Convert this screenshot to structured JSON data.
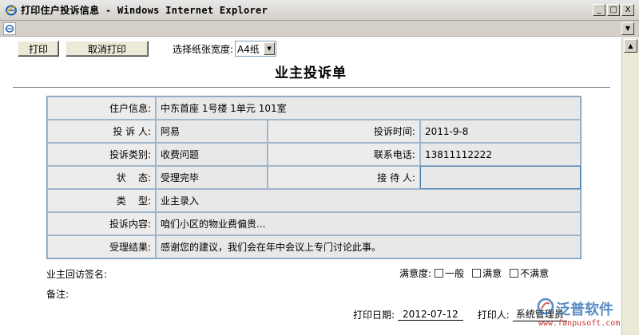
{
  "window": {
    "title": "打印住户投诉信息 - Windows Internet Explorer",
    "minimize_glyph": "_",
    "maximize_glyph": "□",
    "close_glyph": "X"
  },
  "icons": {
    "title": "internet-explorer-icon",
    "address": "page-icon"
  },
  "toolbar": {
    "print_label": "打印",
    "cancel_print_label": "取消打印",
    "paper_width_label": "选择纸张宽度:",
    "paper_width_value": "A4纸"
  },
  "document": {
    "title": "业主投诉单"
  },
  "form": {
    "resident_info_label": "住户信息:",
    "resident_info_value": "中东首座  1号楼  1单元  101室",
    "complainant_label": "投 诉 人:",
    "complainant_value": "阿易",
    "complaint_time_label": "投诉时间:",
    "complaint_time_value": "2011-9-8",
    "category_label": "投诉类别:",
    "category_value": "收费问题",
    "phone_label": "联系电话:",
    "phone_value": "13811112222",
    "status_label": "状    态:",
    "status_value": "受理完毕",
    "receiver_label": "接 待 人:",
    "receiver_value": "",
    "type_label": "类    型:",
    "type_value": "业主录入",
    "content_label": "投诉内容:",
    "content_value": "咱们小区的物业费偏贵...",
    "result_label": "受理结果:",
    "result_value": "感谢您的建议，我们会在年中会议上专门讨论此事。"
  },
  "followup": {
    "sign_label": "业主回访签名:",
    "satisfaction_label": "满意度:",
    "options": [
      "一般",
      "满意",
      "不满意"
    ],
    "remark_label": "备注:"
  },
  "footer": {
    "print_date_label": "打印日期:",
    "print_date_value": "2012-07-12",
    "printer_label": "打印人:",
    "printer_value": "系统管理员"
  },
  "watermark": {
    "brand": "泛普软件",
    "url": "www.fanpusoft.com"
  },
  "colors": {
    "table_border": "#7a9fbf",
    "watermark_blue": "#2e6fb8",
    "watermark_red": "#cc3333"
  }
}
